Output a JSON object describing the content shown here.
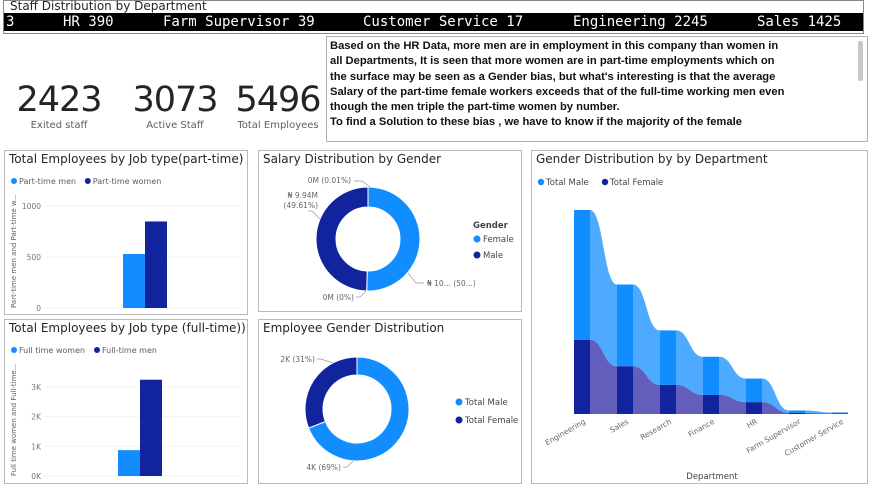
{
  "ticker": {
    "title": "Staff Distribution by Department",
    "items": [
      "3",
      "HR 390",
      "Farm Supervisor 39",
      "Customer Service 17",
      "Engineering 2245",
      "Sales 1425"
    ]
  },
  "kpis": [
    {
      "value": "2423",
      "label": "Exited staff"
    },
    {
      "value": "3073",
      "label": "Active Staff"
    },
    {
      "value": "5496",
      "label": "Total Employees"
    }
  ],
  "narrative": {
    "lines": [
      "Based on the HR Data, more men are in employment in this company than women in",
      "all Departments, It is seen that more women are in part-time employments which on",
      "the surface may be seen as a Gender bias, but what's interesting is that the average",
      "Salary of the part-time female workers exceeds that of the full-time working men even",
      "though the men triple the part-time women by number.",
      "To find a Solution to these bias , we have to know if the majority of the female"
    ]
  },
  "colors": {
    "light_blue": "#118dff",
    "dark_blue": "#12239e"
  },
  "chart_data": [
    {
      "type": "bar",
      "title": "Total Employees by Job type(part-time)",
      "ylabel": "Part-time men and Part-time w...",
      "ylim": [
        0,
        1100
      ],
      "yticks": [
        {
          "v": 0,
          "label": "0"
        },
        {
          "v": 500,
          "label": "500"
        },
        {
          "v": 1000,
          "label": "1000"
        }
      ],
      "series": [
        {
          "name": "Part-time men",
          "values": [
            530
          ]
        },
        {
          "name": "Part-time women",
          "values": [
            850
          ]
        }
      ],
      "legend": "top-left"
    },
    {
      "type": "bar",
      "title": "Total Employees by Job type (full-time))",
      "ylabel": "Full time women and Full-time...",
      "ylim": [
        0,
        3500
      ],
      "yticks": [
        {
          "v": 0,
          "label": "0K"
        },
        {
          "v": 1000,
          "label": "1K"
        },
        {
          "v": 2000,
          "label": "2K"
        },
        {
          "v": 3000,
          "label": "3K"
        }
      ],
      "series": [
        {
          "name": "Full time women",
          "values": [
            870
          ]
        },
        {
          "name": "Full-time men",
          "values": [
            3240
          ]
        }
      ],
      "legend": "top-left"
    },
    {
      "type": "pie",
      "title": "Salary Distribution by Gender",
      "legend_title": "Gender",
      "slices": [
        {
          "name": "Female",
          "value": 50.39,
          "label": "₦ 10... (50...)"
        },
        {
          "name": "Male",
          "value": 49.61,
          "label": "₦ 9.94M (49.61%)"
        }
      ],
      "extra_labels": [
        "0M (0.01%)",
        "0M (0%)"
      ]
    },
    {
      "type": "pie",
      "title": "Employee Gender Distribution",
      "slices": [
        {
          "name": "Total Male",
          "value": 69,
          "label": "4K (69%)"
        },
        {
          "name": "Total Female",
          "value": 31,
          "label": "2K (31%)"
        }
      ]
    },
    {
      "type": "area",
      "title": "Gender Distribution by by Department",
      "xlabel": "Department",
      "categories": [
        "Engineering",
        "Sales",
        "Research",
        "Finance",
        "HR",
        "Farm Supervisor",
        "Customer Service"
      ],
      "series": [
        {
          "name": "Total Male",
          "values": [
            1430,
            900,
            600,
            420,
            260,
            27,
            12
          ]
        },
        {
          "name": "Total Female",
          "values": [
            815,
            525,
            320,
            210,
            130,
            12,
            5
          ]
        }
      ],
      "legend": "top-left"
    }
  ]
}
